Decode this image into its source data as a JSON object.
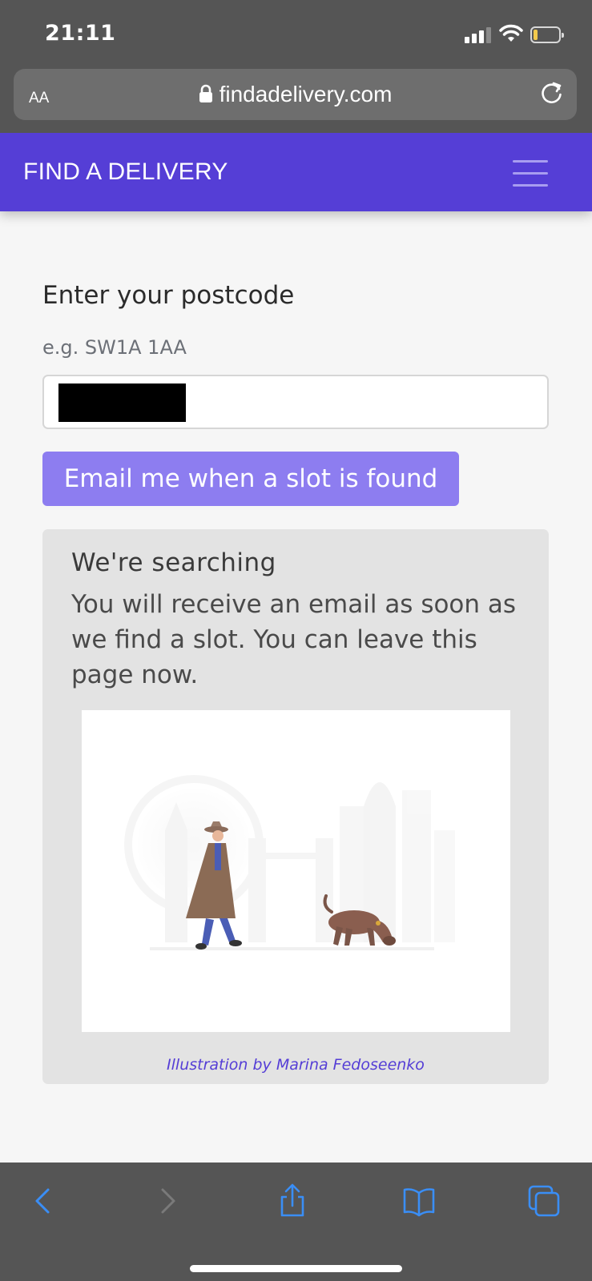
{
  "status_bar": {
    "time": "21:11"
  },
  "browser": {
    "text_size_label": "AA",
    "url": "findadelivery.com"
  },
  "header": {
    "brand": "FIND A DELIVERY"
  },
  "form": {
    "label": "Enter your postcode",
    "hint": "e.g. SW1A 1AA",
    "submit_label": "Email me when a slot is found"
  },
  "status_panel": {
    "title": "We're searching",
    "message": "You will receive an email as soon as we find a slot. You can leave this page now.",
    "credit": "Illustration by Marina Fedoseenko"
  },
  "colors": {
    "brand": "#553ed6",
    "button": "#8d7df0",
    "browser_chrome": "#555555",
    "toolbar_icon": "#3a8ef6"
  }
}
